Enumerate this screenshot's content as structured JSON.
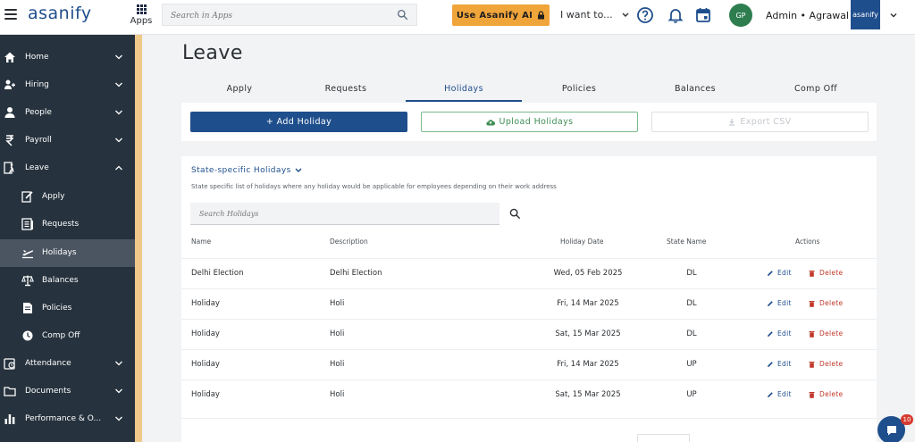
{
  "topbar": {
    "brand": "asanify",
    "apps_label": "Apps",
    "search_placeholder": "Search in Apps",
    "ai_button_label": "Use Asanify AI",
    "want_to_label": "I want to...",
    "avatar_initials": "GP",
    "user_name": "Admin • Agrawal",
    "company_logo_text": "asanify",
    "icons": [
      "menu-icon",
      "apps-icon",
      "search-icon",
      "lock-icon",
      "help-icon",
      "bell-icon",
      "calendar-icon",
      "chevron-down-icon"
    ]
  },
  "sidebar": {
    "items": [
      {
        "label": "Home",
        "icon": "home-icon"
      },
      {
        "label": "Hiring",
        "icon": "hiring-icon"
      },
      {
        "label": "People",
        "icon": "people-icon"
      },
      {
        "label": "Payroll",
        "icon": "rupee-icon"
      },
      {
        "label": "Leave",
        "icon": "leave-icon"
      },
      {
        "label": "Apply",
        "icon": "apply-icon"
      },
      {
        "label": "Requests",
        "icon": "requests-icon"
      },
      {
        "label": "Holidays",
        "icon": "plane-icon"
      },
      {
        "label": "Balances",
        "icon": "scale-icon"
      },
      {
        "label": "Policies",
        "icon": "document-icon"
      },
      {
        "label": "Comp Off",
        "icon": "clock-icon"
      },
      {
        "label": "Attendance",
        "icon": "attendance-icon"
      },
      {
        "label": "Documents",
        "icon": "folder-icon"
      },
      {
        "label": "Performance & O...",
        "icon": "performance-icon"
      }
    ],
    "active_item": "Holidays",
    "accent_color": "#eec98a"
  },
  "main": {
    "title": "Leave",
    "tabs": [
      {
        "label": "Apply"
      },
      {
        "label": "Requests"
      },
      {
        "label": "Holidays"
      },
      {
        "label": "Policies"
      },
      {
        "label": "Balances"
      },
      {
        "label": "Comp Off"
      }
    ],
    "active_tab": "Holidays",
    "actions": {
      "add_label": "+ Add Holiday",
      "upload_label": "Upload Holidays",
      "export_label": "Export CSV"
    },
    "section": {
      "title": "State-specific Holidays",
      "description": "State specific list of holidays where any holiday would be applicable for employees depending on their work address",
      "search_placeholder": "Search Holidays"
    },
    "table": {
      "columns": [
        "Name",
        "Description",
        "Holiday Date",
        "State Name",
        "Actions"
      ],
      "edit_label": "Edit",
      "delete_label": "Delete",
      "rows": [
        {
          "name": "Delhi Election",
          "description": "Delhi Election",
          "date": "Wed, 05 Feb 2025",
          "state": "DL"
        },
        {
          "name": "Holiday",
          "description": "Holi",
          "date": "Fri, 14 Mar 2025",
          "state": "DL"
        },
        {
          "name": "Holiday",
          "description": "Holi",
          "date": "Sat, 15 Mar 2025",
          "state": "DL"
        },
        {
          "name": "Holiday",
          "description": "Holi",
          "date": "Fri, 14 Mar 2025",
          "state": "UP"
        },
        {
          "name": "Holiday",
          "description": "Holi",
          "date": "Sat, 15 Mar 2025",
          "state": "UP"
        }
      ]
    }
  },
  "chat": {
    "badge_count": "10"
  },
  "colors": {
    "primary": "#1f4e8c",
    "ai_button": "#f0a53a",
    "upload_green": "#3f8f56",
    "delete_red": "#c0392b",
    "sidebar_bg": "#26323d",
    "avatar_bg": "#2e7d4f"
  }
}
